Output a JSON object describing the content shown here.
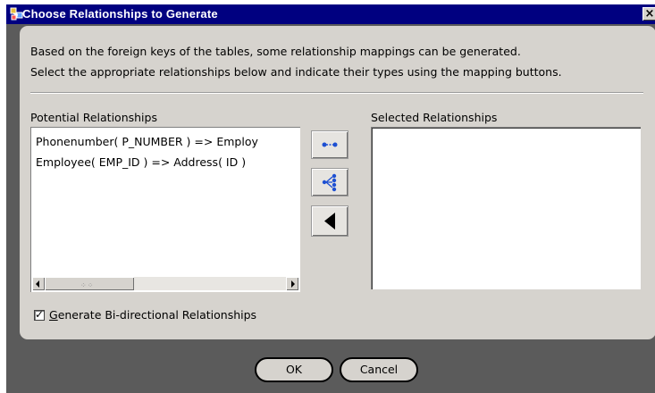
{
  "window": {
    "title": "Choose Relationships to Generate",
    "close_glyph": "×"
  },
  "description": {
    "line1": "Based on the foreign keys of the tables, some relationship mappings can be generated.",
    "line2": "Select the appropriate relationships below and indicate their types using the mapping buttons."
  },
  "potential": {
    "label": "Potential Relationships",
    "items": [
      "Phonenumber( P_NUMBER ) => Employ",
      "Employee( EMP_ID ) => Address( ID )"
    ]
  },
  "selected": {
    "label": "Selected Relationships",
    "items": []
  },
  "mapping_buttons": [
    {
      "icon": "one-to-one-icon"
    },
    {
      "icon": "one-to-many-icon"
    },
    {
      "icon": "remove-left-icon"
    }
  ],
  "options": {
    "bidirectional_label": "Generate Bi-directional Relationships",
    "bidirectional_checked": true,
    "check_glyph": "✓"
  },
  "buttons": {
    "ok": "OK",
    "cancel": "Cancel"
  },
  "colors": {
    "title_bar": "#000080",
    "dialog_bg": "#d6d3ce",
    "frame_bg": "#5b5b5b",
    "icon_blue": "#1e50d2"
  }
}
